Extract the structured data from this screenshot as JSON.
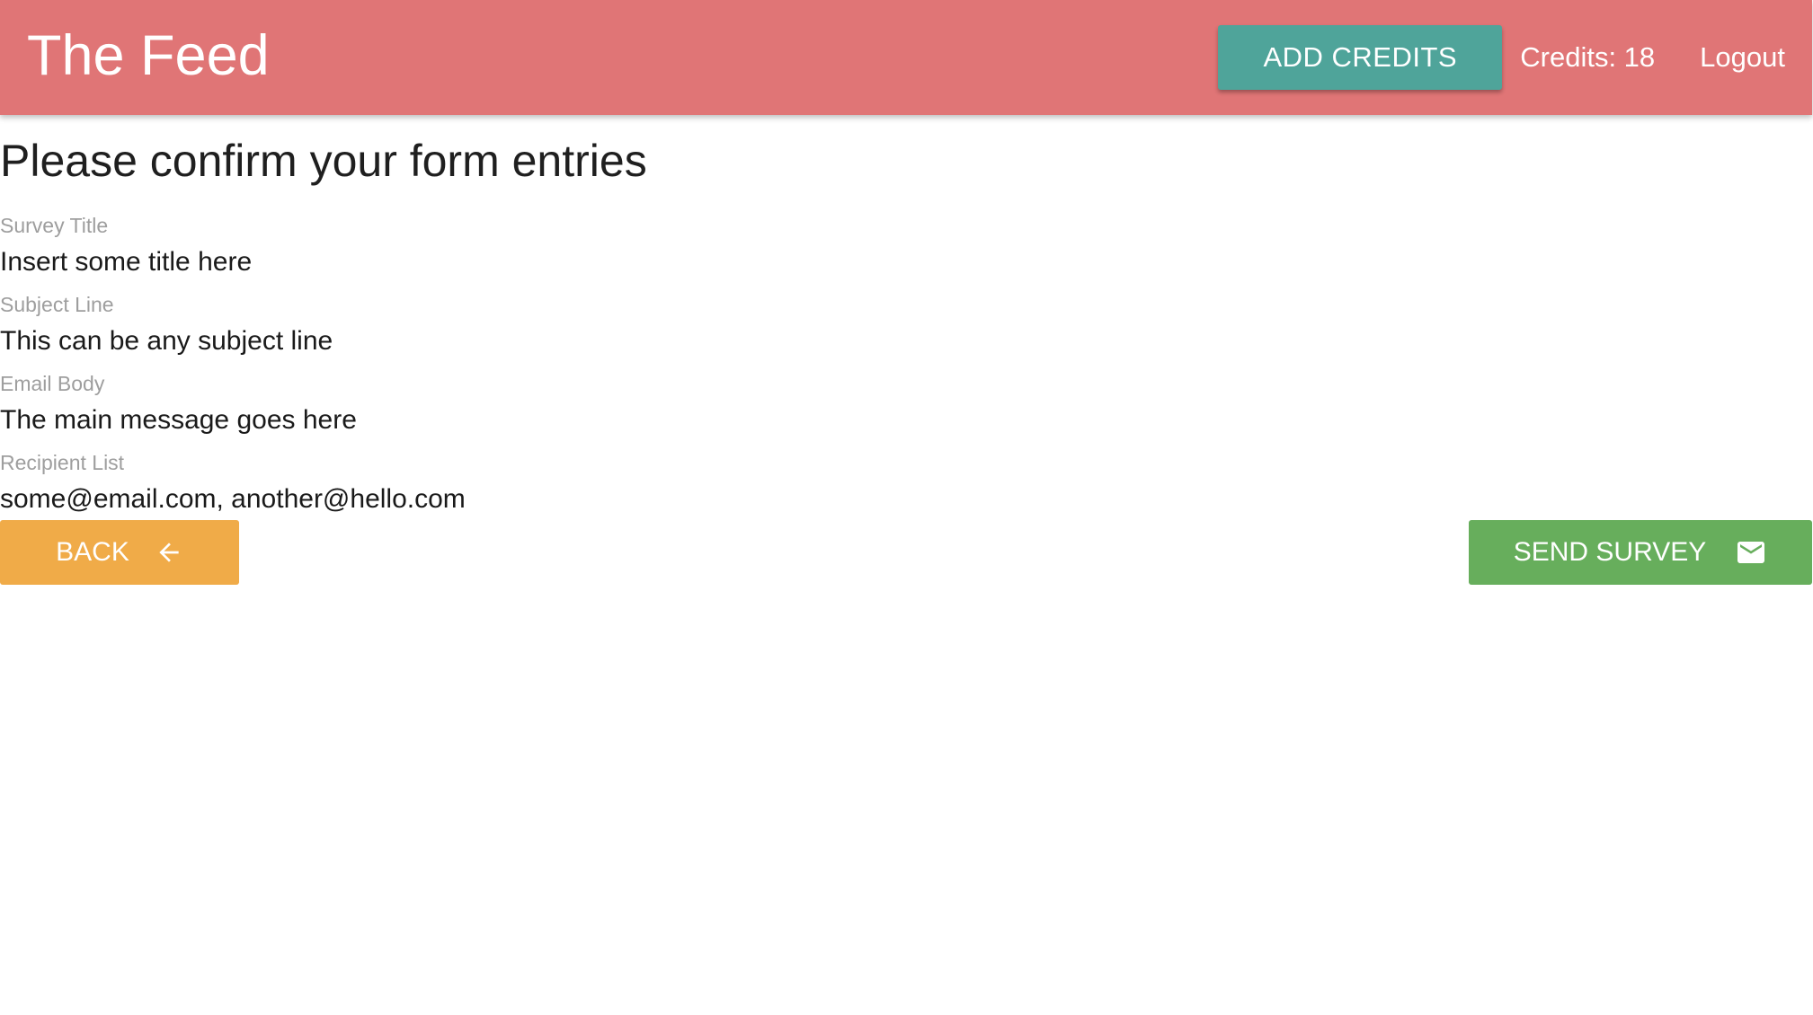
{
  "header": {
    "brand": "The Feed",
    "add_credits_label": "ADD CREDITS",
    "credits_text": "Credits: 18",
    "logout_label": "Logout"
  },
  "main": {
    "title": "Please confirm your form entries",
    "fields": [
      {
        "label": "Survey Title",
        "value": "Insert some title here"
      },
      {
        "label": "Subject Line",
        "value": "This can be any subject line"
      },
      {
        "label": "Email Body",
        "value": "The main message goes here"
      },
      {
        "label": "Recipient List",
        "value": "some@email.com, another@hello.com"
      }
    ],
    "back_label": "BACK",
    "back_icon": "arrow-back-icon",
    "send_label": "SEND SURVEY",
    "send_icon": "email-icon"
  },
  "colors": {
    "navbar": "#e07576",
    "add_credits": "#4fa49a",
    "back": "#f0ab48",
    "send": "#67ae5c"
  }
}
